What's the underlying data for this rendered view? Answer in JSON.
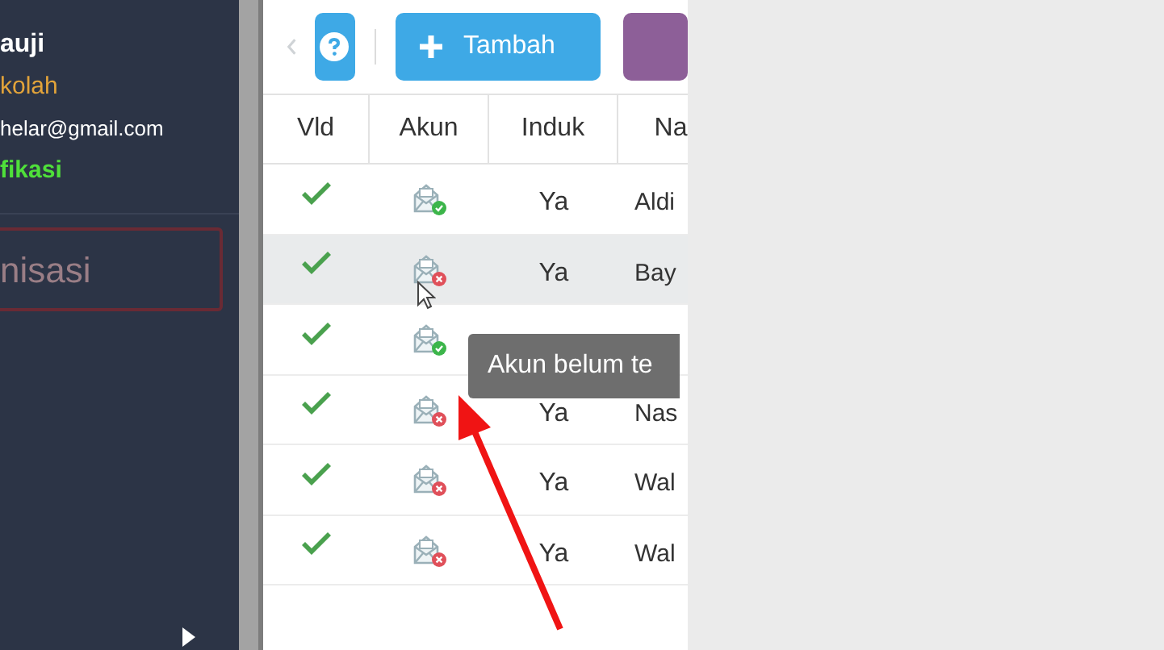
{
  "sidebar": {
    "name": "auji",
    "role": "kolah",
    "email": "helar@gmail.com",
    "status": "fikasi",
    "menu_item": "nisasi"
  },
  "toolbar": {
    "add_button": "Tambah"
  },
  "table": {
    "columns": [
      "Vld",
      "Akun",
      "Induk",
      "Na"
    ],
    "rows": [
      {
        "valid": true,
        "account_linked": true,
        "induk": "Ya",
        "nama": "Aldi",
        "selected": false
      },
      {
        "valid": true,
        "account_linked": false,
        "induk": "Ya",
        "nama": "Bay",
        "selected": true
      },
      {
        "valid": true,
        "account_linked": true,
        "selected": false
      },
      {
        "valid": true,
        "account_linked": false,
        "induk": "Ya",
        "nama": "Nas",
        "selected": false
      },
      {
        "valid": true,
        "account_linked": false,
        "induk": "Ya",
        "nama": "Wal",
        "selected": false
      },
      {
        "valid": true,
        "account_linked": false,
        "induk": "Ya",
        "nama": "Wal",
        "selected": false
      }
    ]
  },
  "tooltip": "Akun belum te"
}
